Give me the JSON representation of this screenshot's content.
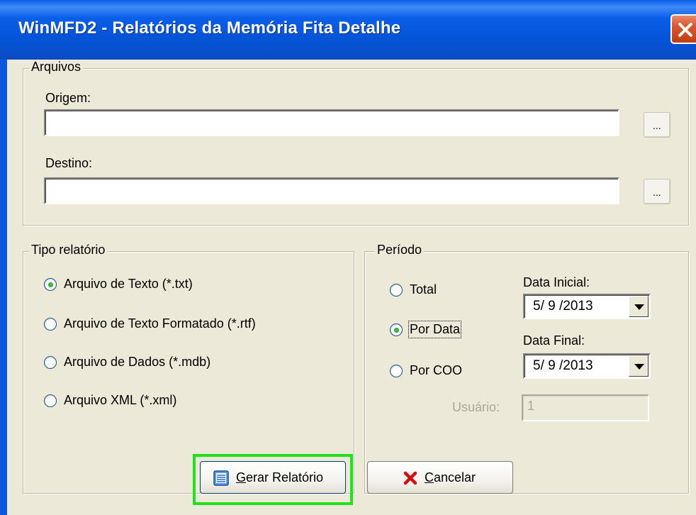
{
  "window": {
    "title": "WinMFD2 - Relatórios da Memória Fita Detalhe"
  },
  "arquivos": {
    "legend": "Arquivos",
    "origem_label": "Origem:",
    "origem_value": "",
    "destino_label": "Destino:",
    "destino_value": "",
    "browse_label": "..."
  },
  "tipo": {
    "legend": "Tipo relatório",
    "options": [
      {
        "label": "Arquivo de Texto (*.txt)",
        "checked": true
      },
      {
        "label": "Arquivo de Texto Formatado (*.rtf)",
        "checked": false
      },
      {
        "label": "Arquivo de Dados (*.mdb)",
        "checked": false
      },
      {
        "label": "Arquivo XML (*.xml)",
        "checked": false
      }
    ]
  },
  "periodo": {
    "legend": "Período",
    "options": [
      {
        "label": "Total",
        "checked": false
      },
      {
        "label": "Por Data",
        "checked": true
      },
      {
        "label": "Por COO",
        "checked": false
      }
    ],
    "data_inicial_label": "Data Inicial:",
    "data_inicial_value": "5/ 9 /2013",
    "data_final_label": "Data Final:",
    "data_final_value": "5/ 9 /2013",
    "usuario_label": "Usuário:",
    "usuario_value": "1"
  },
  "buttons": {
    "gerar_mnemonic": "G",
    "gerar_rest": "erar Relatório",
    "cancelar_mnemonic": "C",
    "cancelar_rest": "ancelar"
  },
  "colors": {
    "highlight": "#1ee21e",
    "titlebar": "#0a5ee8",
    "dialog_bg": "#ece9d8"
  }
}
